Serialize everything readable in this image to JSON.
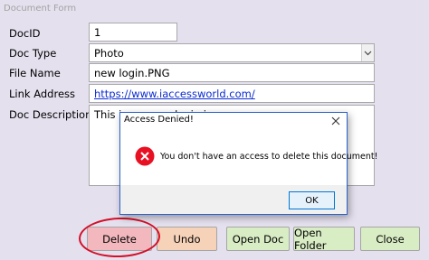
{
  "form": {
    "title": "Document Form",
    "fields": {
      "doc_id": {
        "label": "DocID",
        "value": "1"
      },
      "doc_type": {
        "label": "Doc Type",
        "value": "Photo"
      },
      "file_name": {
        "label": "File Name",
        "value": "new login.PNG"
      },
      "link_address": {
        "label": "Link Address",
        "value": "https://www.iaccessworld.com/"
      },
      "doc_description": {
        "label": "Doc Description",
        "value": "This is my new login image"
      }
    },
    "buttons": {
      "delete": "Delete",
      "undo": "Undo",
      "open_doc": "Open Doc",
      "open_folder": "Open Folder",
      "close": "Close"
    }
  },
  "dialog": {
    "title": "Access Denied!",
    "message": "You don't have an access to delete this document!",
    "ok_label": "OK",
    "icon": "error-icon"
  },
  "colors": {
    "form_background": "#e4e0ee",
    "delete_button": "#f2b8bd",
    "undo_button": "#f6d2b8",
    "green_buttons": "#d9edc5",
    "annotation_circle": "#d40f28",
    "error_icon": "#e81123"
  }
}
